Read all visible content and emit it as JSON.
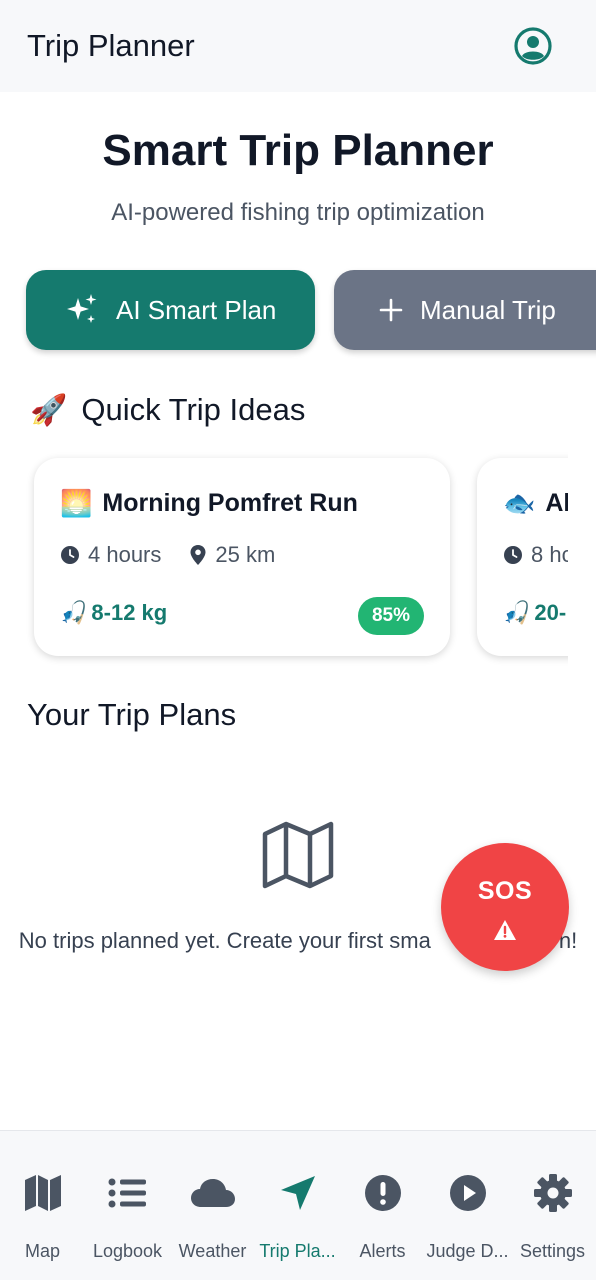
{
  "appbar": {
    "title": "Trip Planner",
    "profile_icon": "account-circle-icon"
  },
  "hero": {
    "title": "Smart Trip Planner",
    "subtitle": "AI-powered fishing trip optimization"
  },
  "actions": {
    "ai_plan_label": "AI Smart Plan",
    "ai_plan_icon": "sparkles-icon",
    "manual_label": "Manual Trip",
    "manual_icon": "plus-icon"
  },
  "quick_ideas": {
    "title": "Quick Trip Ideas",
    "emoji": "🚀",
    "cards": [
      {
        "emoji": "🌅",
        "name": "Morning Pomfret Run",
        "duration": "4 hours",
        "distance": "25 km",
        "catch_emoji": "🎣",
        "catch": "8-12 kg",
        "score": "85%"
      },
      {
        "emoji": "🐟",
        "name": "Al",
        "duration": "8 hc",
        "catch_emoji": "🎣",
        "catch": "20-"
      }
    ]
  },
  "your_plans": {
    "title": "Your Trip Plans",
    "empty_icon": "map-icon",
    "empty_text": "No trips planned yet. Create your first sma",
    "empty_text_tail": "n!"
  },
  "sos": {
    "label": "SOS",
    "icon": "warning-icon"
  },
  "nav": {
    "items": [
      {
        "label": "Map",
        "icon": "map-icon"
      },
      {
        "label": "Logbook",
        "icon": "list-icon"
      },
      {
        "label": "Weather",
        "icon": "cloud-icon"
      },
      {
        "label": "Trip Pla...",
        "icon": "navigation-arrow-icon"
      },
      {
        "label": "Alerts",
        "icon": "alert-circle-icon"
      },
      {
        "label": "Judge D...",
        "icon": "play-circle-icon"
      },
      {
        "label": "Settings",
        "icon": "gear-icon"
      }
    ],
    "active_index": 3
  },
  "colors": {
    "primary": "#157a6e",
    "secondary_button": "#6b7486",
    "sos": "#f04445",
    "badge": "#22b573",
    "text": "#111827"
  }
}
